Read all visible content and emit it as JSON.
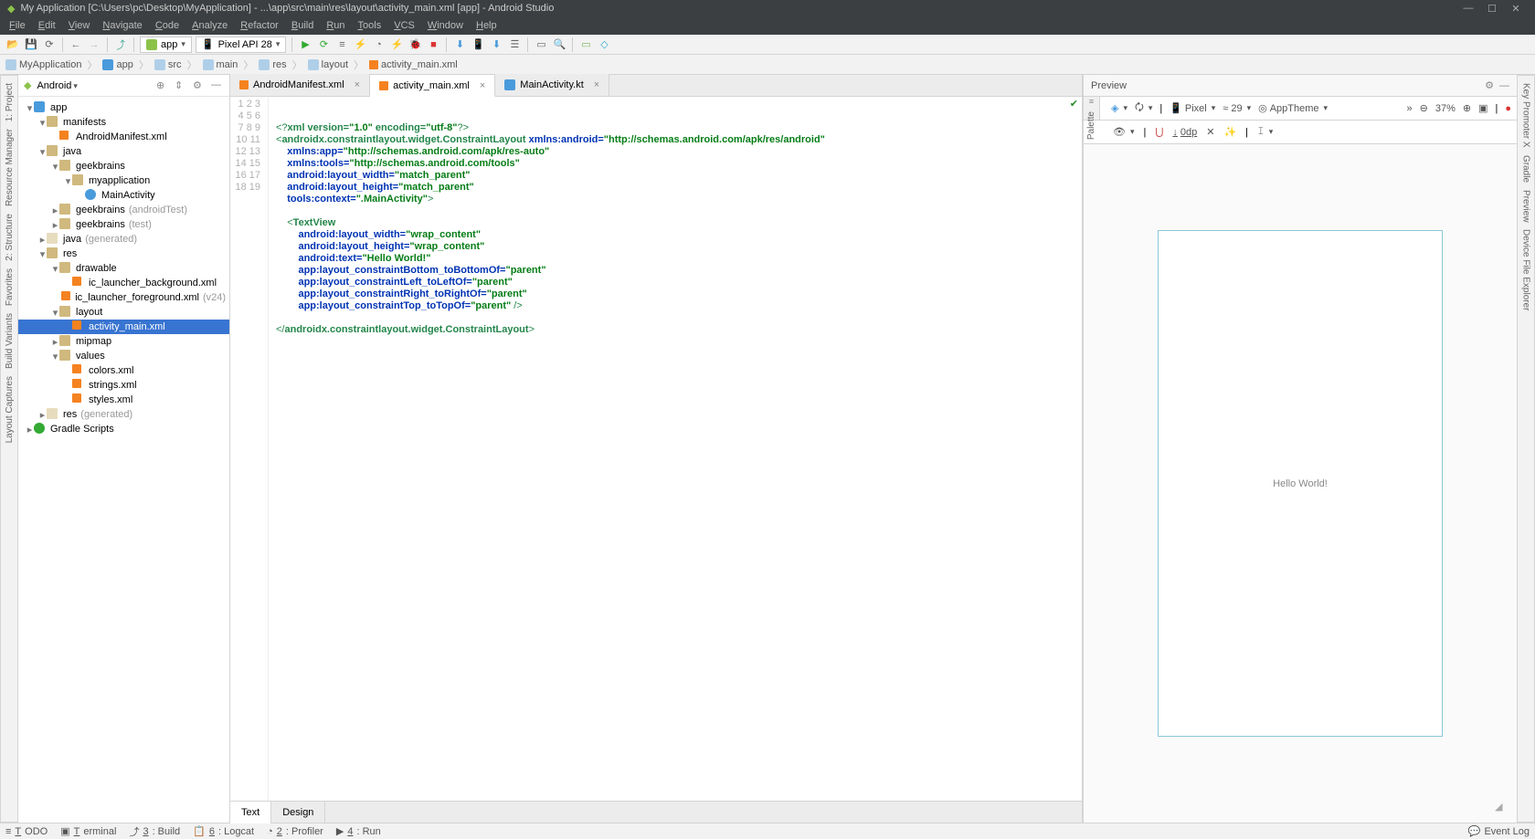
{
  "window": {
    "title": "My Application [C:\\Users\\pc\\Desktop\\MyApplication] - ...\\app\\src\\main\\res\\layout\\activity_main.xml [app] - Android Studio"
  },
  "menu": [
    "File",
    "Edit",
    "View",
    "Navigate",
    "Code",
    "Analyze",
    "Refactor",
    "Build",
    "Run",
    "Tools",
    "VCS",
    "Window",
    "Help"
  ],
  "toolbar": {
    "run_config": "app",
    "device": "Pixel API 28"
  },
  "breadcrumbs": [
    {
      "label": "MyApplication",
      "icon": "folder"
    },
    {
      "label": "app",
      "icon": "module"
    },
    {
      "label": "src",
      "icon": "folder"
    },
    {
      "label": "main",
      "icon": "folder"
    },
    {
      "label": "res",
      "icon": "folder"
    },
    {
      "label": "layout",
      "icon": "folder"
    },
    {
      "label": "activity_main.xml",
      "icon": "xml"
    }
  ],
  "left_rail": [
    "1: Project",
    "Resource Manager",
    "2: Structure",
    "Favorites",
    "Build Variants",
    "Layout Captures"
  ],
  "right_rail": [
    "Key Promoter X",
    "Gradle",
    "Preview",
    "Device File Explorer"
  ],
  "project": {
    "selector": "Android",
    "tree": [
      {
        "label": "app",
        "depth": 0,
        "arrow": "▾",
        "icon": "module"
      },
      {
        "label": "manifests",
        "depth": 1,
        "arrow": "▾",
        "icon": "folder"
      },
      {
        "label": "AndroidManifest.xml",
        "depth": 2,
        "arrow": "",
        "icon": "xml"
      },
      {
        "label": "java",
        "depth": 1,
        "arrow": "▾",
        "icon": "folder"
      },
      {
        "label": "geekbrains",
        "depth": 2,
        "arrow": "▾",
        "icon": "pkg"
      },
      {
        "label": "myapplication",
        "depth": 3,
        "arrow": "▾",
        "icon": "pkg"
      },
      {
        "label": "MainActivity",
        "depth": 4,
        "arrow": "",
        "icon": "kt"
      },
      {
        "label": "geekbrains",
        "note": "(androidTest)",
        "depth": 2,
        "arrow": "▸",
        "icon": "pkg"
      },
      {
        "label": "geekbrains",
        "note": "(test)",
        "depth": 2,
        "arrow": "▸",
        "icon": "pkg"
      },
      {
        "label": "java",
        "note": "(generated)",
        "depth": 1,
        "arrow": "▸",
        "icon": "folder-gen"
      },
      {
        "label": "res",
        "depth": 1,
        "arrow": "▾",
        "icon": "folder"
      },
      {
        "label": "drawable",
        "depth": 2,
        "arrow": "▾",
        "icon": "folder"
      },
      {
        "label": "ic_launcher_background.xml",
        "depth": 3,
        "arrow": "",
        "icon": "xml"
      },
      {
        "label": "ic_launcher_foreground.xml",
        "note": "(v24)",
        "depth": 3,
        "arrow": "",
        "icon": "xml"
      },
      {
        "label": "layout",
        "depth": 2,
        "arrow": "▾",
        "icon": "folder"
      },
      {
        "label": "activity_main.xml",
        "depth": 3,
        "arrow": "",
        "icon": "xml",
        "selected": true
      },
      {
        "label": "mipmap",
        "depth": 2,
        "arrow": "▸",
        "icon": "folder"
      },
      {
        "label": "values",
        "depth": 2,
        "arrow": "▾",
        "icon": "folder"
      },
      {
        "label": "colors.xml",
        "depth": 3,
        "arrow": "",
        "icon": "xml"
      },
      {
        "label": "strings.xml",
        "depth": 3,
        "arrow": "",
        "icon": "xml"
      },
      {
        "label": "styles.xml",
        "depth": 3,
        "arrow": "",
        "icon": "xml"
      },
      {
        "label": "res",
        "note": "(generated)",
        "depth": 1,
        "arrow": "▸",
        "icon": "folder-gen"
      },
      {
        "label": "Gradle Scripts",
        "depth": 0,
        "arrow": "▸",
        "icon": "gradle"
      }
    ]
  },
  "editor": {
    "tabs": [
      {
        "label": "AndroidManifest.xml",
        "icon": "xml",
        "active": false,
        "closable": true
      },
      {
        "label": "activity_main.xml",
        "icon": "xml",
        "active": true,
        "closable": true
      },
      {
        "label": "MainActivity.kt",
        "icon": "kt",
        "active": false,
        "closable": true
      }
    ],
    "line_count": 19,
    "bottom_tabs": [
      {
        "label": "Text",
        "active": true
      },
      {
        "label": "Design",
        "active": false
      }
    ]
  },
  "preview": {
    "title": "Preview",
    "toolbar": {
      "device": "Pixel",
      "api": "29",
      "theme": "AppTheme",
      "zoom": "37%",
      "margin": "0dp"
    },
    "content_text": "Hello World!"
  },
  "statusbar": {
    "items": [
      "TODO",
      "Terminal",
      "3: Build",
      "6: Logcat",
      "2: Profiler",
      "4: Run"
    ],
    "right": "Event Log"
  },
  "code": {
    "l1_a": "<?",
    "l1_b": "xml version=",
    "l1_c": "\"1.0\"",
    "l1_d": " encoding=",
    "l1_e": "\"utf-8\"",
    "l1_f": "?>",
    "l2_a": "<",
    "l2_b": "androidx.constraintlayout.widget.ConstraintLayout",
    "l2_c": " xmlns:android=",
    "l2_d": "\"http://schemas.android.com/apk/res/android\"",
    "l3_a": "xmlns:app=",
    "l3_b": "\"http://schemas.android.com/apk/res-auto\"",
    "l4_a": "xmlns:tools=",
    "l4_b": "\"http://schemas.android.com/tools\"",
    "l5_a": "android:layout_width=",
    "l5_b": "\"match_parent\"",
    "l6_a": "android:layout_height=",
    "l6_b": "\"match_parent\"",
    "l7_a": "tools:context=",
    "l7_b": "\".MainActivity\"",
    "l7_c": ">",
    "l9_a": "<",
    "l9_b": "TextView",
    "l10_a": "android:layout_width=",
    "l10_b": "\"wrap_content\"",
    "l11_a": "android:layout_height=",
    "l11_b": "\"wrap_content\"",
    "l12_a": "android:text=",
    "l12_b": "\"Hello World!\"",
    "l13_a": "app:layout_constraintBottom_toBottomOf=",
    "l13_b": "\"parent\"",
    "l14_a": "app:layout_constraintLeft_toLeftOf=",
    "l14_b": "\"parent\"",
    "l15_a": "app:layout_constraintRight_toRightOf=",
    "l15_b": "\"parent\"",
    "l16_a": "app:layout_constraintTop_toTopOf=",
    "l16_b": "\"parent\"",
    "l16_c": " />",
    "l18_a": "</",
    "l18_b": "androidx.constraintlayout.widget.ConstraintLayout",
    "l18_c": ">"
  }
}
